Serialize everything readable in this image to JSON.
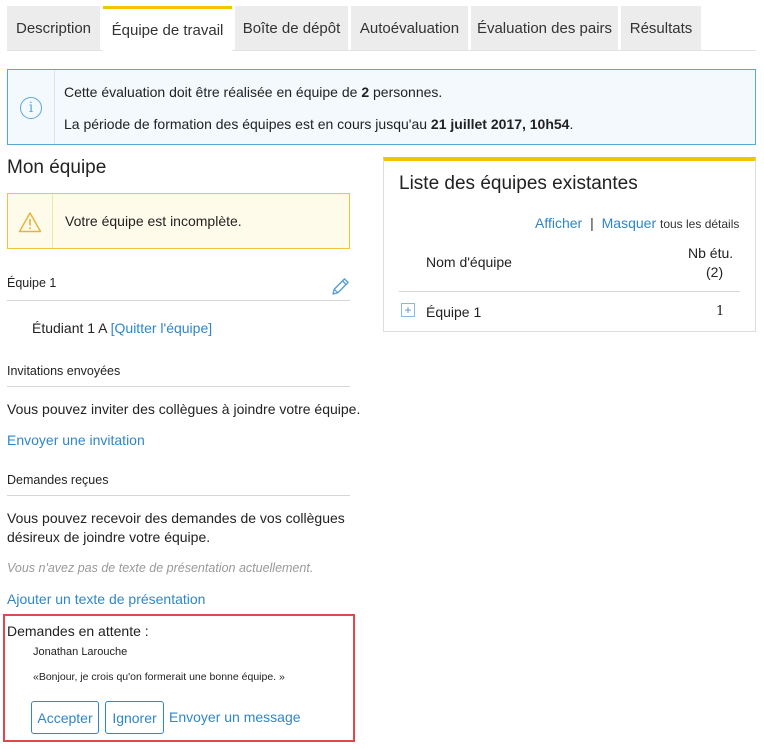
{
  "tabs": [
    {
      "label": "Description"
    },
    {
      "label": "Équipe de travail"
    },
    {
      "label": "Boîte de dépôt"
    },
    {
      "label": "Autoévaluation"
    },
    {
      "label": "Évaluation des pairs"
    },
    {
      "label": "Résultats"
    }
  ],
  "active_tab": "Équipe de travail",
  "info": {
    "line1_pre": "Cette évaluation doit être réalisée en équipe de ",
    "line1_num": "2",
    "line1_post": " personnes.",
    "line2_pre": "La période de formation des équipes est en cours jusqu'au ",
    "line2_date": "21 juillet 2017, 10h54",
    "line2_post": "."
  },
  "my_team": {
    "title": "Mon équipe",
    "warning": "Votre équipe est incomplète.",
    "team_name": "Équipe 1",
    "member": "Étudiant 1 A ",
    "leave_link": "[Quitter l'équipe]"
  },
  "invitations": {
    "title": "Invitations envoyées",
    "text": "Vous pouvez inviter des collègues à joindre votre équipe.",
    "link": "Envoyer une invitation"
  },
  "requests": {
    "title": "Demandes reçues",
    "text_line1": "Vous pouvez recevoir des demandes de vos collègues",
    "text_line2": "désireux de joindre votre équipe.",
    "no_text": "Vous n'avez pas de texte de présentation actuellement.",
    "add_link": "Ajouter un texte de présentation"
  },
  "pending": {
    "title": "Demandes en attente :",
    "name": "Jonathan Larouche",
    "message": "«Bonjour, je crois qu'on formerait une bonne équipe. »",
    "accept": "Accepter",
    "ignore": "Ignorer",
    "send_message": "Envoyer un message"
  },
  "teams_list": {
    "title": "Liste des équipes existantes",
    "show": "Afficher",
    "separator": "|",
    "hide": "Masquer",
    "details": "tous les détails",
    "col_name": "Nom d'équipe",
    "col_count_line1": "Nb étu.",
    "col_count_line2": "(2)",
    "rows": [
      {
        "name": "Équipe 1",
        "count": "1"
      }
    ]
  },
  "colors": {
    "accent": "#f5c300",
    "link": "#2f86c8",
    "info_border": "#5aa7d8",
    "warning_border": "#f0c43c",
    "highlight_border": "#e0474f"
  },
  "icons": [
    "info-icon",
    "warning-icon",
    "pencil-icon",
    "expand-plus-icon"
  ]
}
